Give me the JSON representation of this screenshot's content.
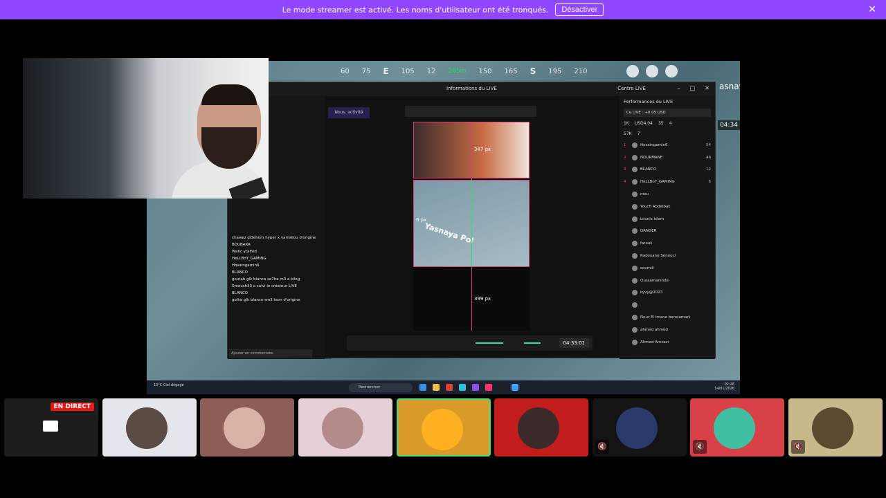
{
  "banner": {
    "message": "Le mode streamer est activé. Les noms d'utilisateur ont été tronqués.",
    "disable_button": "Désactiver",
    "close": "✕",
    "color": "#9146ff"
  },
  "stream": {
    "compass": [
      "60",
      "75",
      "E",
      "105",
      "12",
      "150",
      "165",
      "S",
      "195",
      "210"
    ],
    "compass_marker": "285m",
    "side_text": "asnaya",
    "hud_time": "04:34",
    "obs_window": {
      "title": "Informations du LIVE",
      "centre_label": "Centre LIVE",
      "new_activity": "Nouv. activité",
      "preview_px_top": "347 px",
      "preview_px_bottom": "399 px",
      "preview_px_side": "6 px",
      "game_overlay_text": "Yasnaya Pol",
      "clock": "04:33:01"
    },
    "performance": {
      "title": "Performances du LIVE",
      "diamonds": "Ce LIVE : +0.05 USD",
      "stats": [
        "1K",
        "USD4.04",
        "35",
        "4"
      ],
      "stats2": [
        "57K",
        "7"
      ],
      "rows": [
        {
          "rank": "1",
          "name": "Hosaingamin6",
          "score": "54"
        },
        {
          "rank": "2",
          "name": "NOURMANE",
          "score": "48"
        },
        {
          "rank": "3",
          "name": "BLANCO",
          "score": "12"
        },
        {
          "rank": "4",
          "name": "HeLLBoY_GAMING",
          "score": "6"
        },
        {
          "rank": "",
          "name": "meu",
          "score": ""
        },
        {
          "rank": "",
          "name": "Youcfi Abdelbak",
          "score": ""
        },
        {
          "rank": "",
          "name": "Lôunis Islam",
          "score": ""
        },
        {
          "rank": "",
          "name": "DANGER",
          "score": ""
        },
        {
          "rank": "",
          "name": "farouk",
          "score": ""
        },
        {
          "rank": "",
          "name": "Radouane Senouci",
          "score": ""
        },
        {
          "rank": "",
          "name": "soumiii",
          "score": ""
        },
        {
          "rank": "",
          "name": "Oussamaninde",
          "score": ""
        },
        {
          "rank": "",
          "name": "kyvy@2023",
          "score": ""
        },
        {
          "rank": "",
          "name": "",
          "score": ""
        },
        {
          "rank": "",
          "name": "Nour El Imane bensiamani",
          "score": ""
        },
        {
          "rank": "",
          "name": "ahmed ahmed",
          "score": ""
        },
        {
          "rank": "",
          "name": "Ahmed Amzazi",
          "score": ""
        }
      ]
    },
    "chat": {
      "lines": [
        "chawez gl3ehom hyper x yamsilou d'origine",
        "BOUBAKR",
        "Wahc ytalfed",
        "HeLLBoY_GAMING",
        "Hosaingamin6",
        "BLANCO",
        "goutah glk blanco sa7ha m3 a kilog",
        "Smoush33 a suivi le créateur LIVE",
        "BLANCO",
        "golha glk blanco sm3 hom d'origine"
      ],
      "input_placeholder": "Ajouter un commentaire"
    },
    "taskbar": {
      "weather": "10°C Ciel dégagé",
      "search": "Rechercher",
      "time": "02:28",
      "date": "14/01/2026"
    }
  },
  "participants": [
    {
      "label": "EN DIRECT",
      "bg": "#1d1d1d"
    },
    {
      "label": "",
      "bg": "#e3e6ea"
    },
    {
      "label": "",
      "bg": "#8c5e56"
    },
    {
      "label": "",
      "bg": "#e6cfd7"
    },
    {
      "label": "",
      "bg": "#d89b29"
    },
    {
      "label": "",
      "bg": "#c11d1d"
    },
    {
      "label": "",
      "bg": "#141414"
    },
    {
      "label": "",
      "bg": "#d94148"
    },
    {
      "label": "",
      "bg": "#c9b98a"
    }
  ]
}
